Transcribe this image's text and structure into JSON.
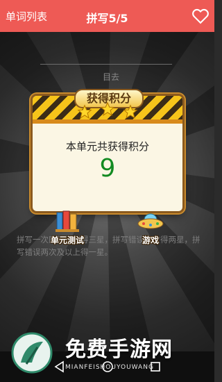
{
  "topbar": {
    "left_label": "单词列表",
    "title": "拼写5/5",
    "heart_icon": "heart-outline-icon"
  },
  "background": {
    "word_hint": "目去",
    "instruction": "拼写一次即可以获得三星，拼写错误一次得两星，拼写错误两次及以上得一星。"
  },
  "dialog": {
    "title": "获得积分",
    "message": "本单元共获得积分",
    "score": "9",
    "stars_earned": 3
  },
  "buttons": {
    "unit_test_label": "单元测试",
    "game_label": "游戏"
  },
  "watermark": {
    "text": "免费手游网",
    "subtext": "MIANFEISHOUYOUWANG"
  },
  "navbar": {
    "back_icon": "back-triangle-icon",
    "home_icon": "home-circle-icon",
    "recent_icon": "recent-square-icon"
  }
}
